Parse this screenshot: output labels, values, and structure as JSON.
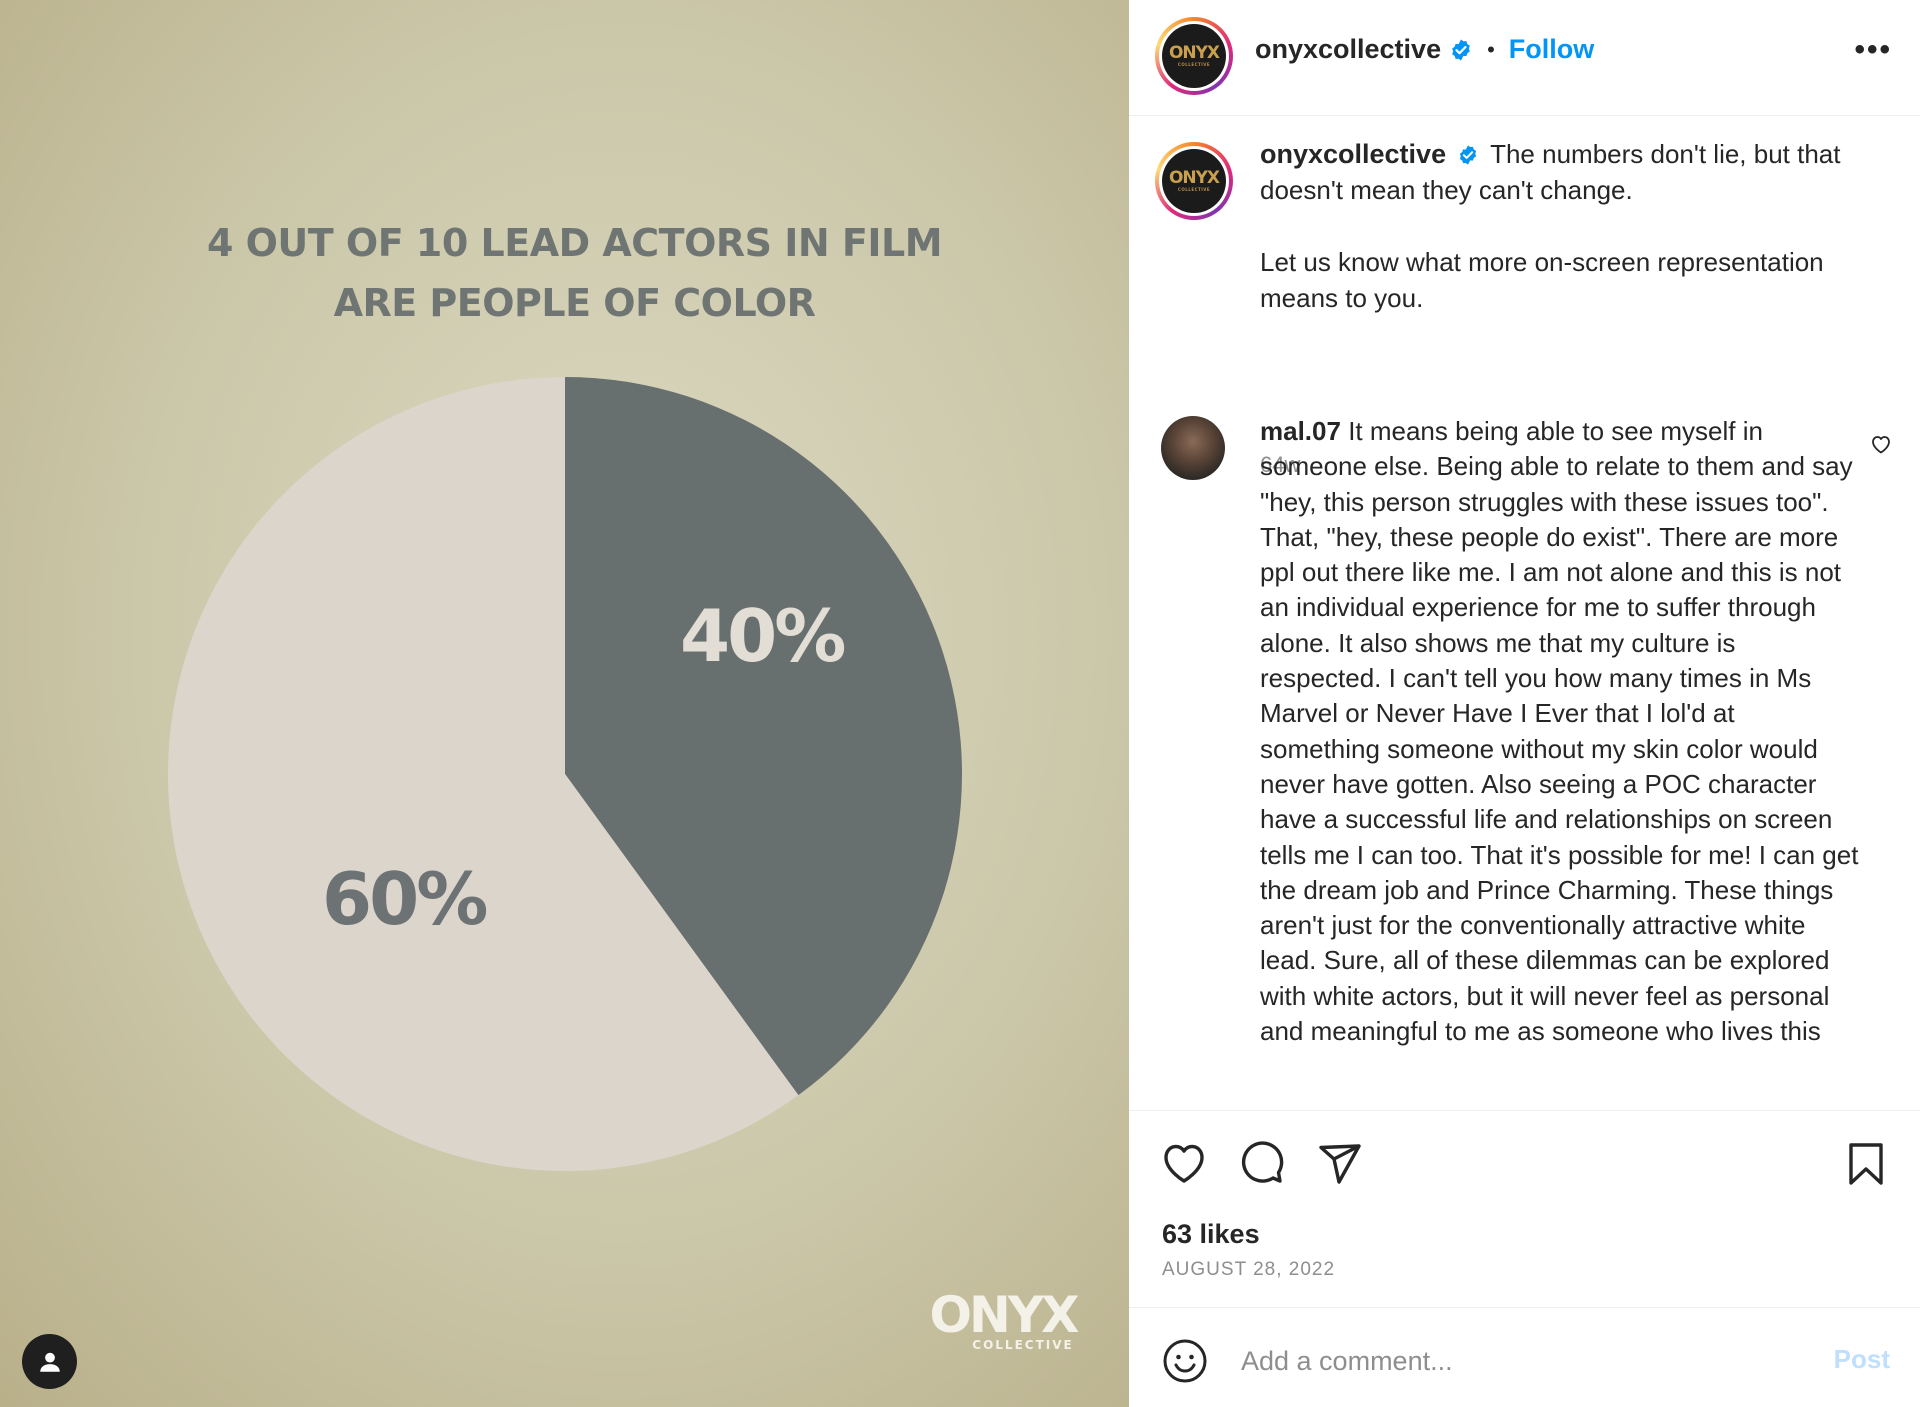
{
  "media": {
    "headline_line1": "4 OUT OF 10 LEAD ACTORS IN FILM",
    "headline_line2": "ARE PEOPLE OF COLOR",
    "logo_text": "ONYX",
    "logo_subtext": "COLLECTIVE",
    "colors": {
      "dark_slice": "#68706f",
      "light_slice": "#dcd5cb"
    }
  },
  "chart_data": {
    "type": "pie",
    "title": "4 OUT OF 10 LEAD ACTORS IN FILM ARE PEOPLE OF COLOR",
    "categories": [
      "",
      ""
    ],
    "values": [
      40,
      60
    ],
    "labels": [
      "40%",
      "60%"
    ]
  },
  "post": {
    "avatar_logo": "ONYX",
    "avatar_sub": "COLLECTIVE",
    "username": "onyxcollective",
    "separator": "•",
    "follow_label": "Follow",
    "more_icon": "more-options-icon",
    "caption_line1": "The numbers don't lie, but that doesn't mean they can't change.",
    "caption_line2": "Let us know what more on-screen representation means to you.",
    "time_ago": "64w"
  },
  "comment": {
    "username": "mal.07",
    "text": "It means being able to see myself in someone else. Being able to relate to them and say \"hey, this person struggles with these issues too\". That, \"hey, these people do exist\". There are more ppl out there like me. I am not alone and this is not an individual experience for me to suffer through alone. It also shows me that my culture is respected. I can't tell you how many times in Ms Marvel or Never Have I Ever that I lol'd at something someone without my skin color would never have gotten. Also seeing a POC character have a successful life and relationships on screen tells me I can too. That it's possible for me! I can get the dream job and Prince Charming. These things aren't just for the conventionally attractive white lead. Sure, all of these dilemmas can be explored with white actors, but it will never feel as personal and meaningful to me as someone who lives this"
  },
  "stats": {
    "likes": "63 likes",
    "date": "AUGUST 28, 2022"
  },
  "add_comment": {
    "placeholder": "Add a comment...",
    "post_label": "Post"
  },
  "colors": {
    "accent": "#0095f6",
    "verified": "#0095f6",
    "post_disabled": "#c0dffd"
  }
}
